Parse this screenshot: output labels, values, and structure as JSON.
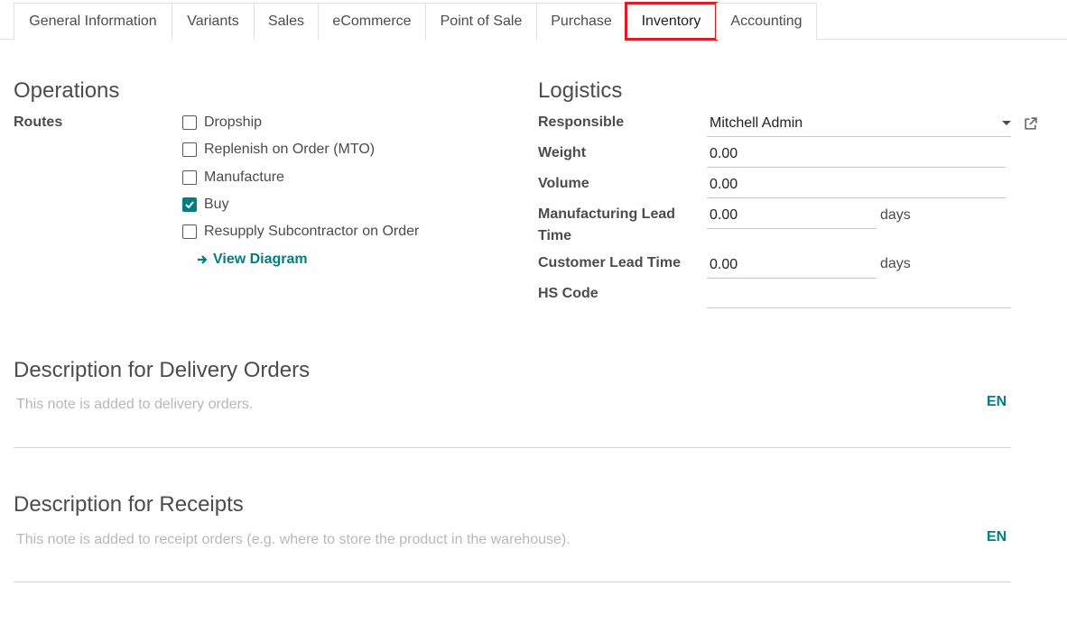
{
  "tabs": [
    {
      "label": "General Information"
    },
    {
      "label": "Variants"
    },
    {
      "label": "Sales"
    },
    {
      "label": "eCommerce"
    },
    {
      "label": "Point of Sale"
    },
    {
      "label": "Purchase"
    },
    {
      "label": "Inventory",
      "active": true
    },
    {
      "label": "Accounting"
    }
  ],
  "operations": {
    "title": "Operations",
    "routes_label": "Routes",
    "routes": [
      {
        "label": "Dropship",
        "checked": false
      },
      {
        "label": "Replenish on Order (MTO)",
        "checked": false
      },
      {
        "label": "Manufacture",
        "checked": false
      },
      {
        "label": "Buy",
        "checked": true
      },
      {
        "label": "Resupply Subcontractor on Order",
        "checked": false
      }
    ],
    "view_diagram": "View Diagram"
  },
  "logistics": {
    "title": "Logistics",
    "responsible_label": "Responsible",
    "responsible_value": "Mitchell Admin",
    "weight_label": "Weight",
    "weight_value": "0.00",
    "volume_label": "Volume",
    "volume_value": "0.00",
    "mfg_lead_label_line1": "Manufacturing Lead",
    "mfg_lead_label_line2": "Time",
    "mfg_lead_value": "0.00",
    "mfg_lead_unit": "days",
    "customer_lead_label": "Customer Lead Time",
    "customer_lead_value": "0.00",
    "customer_lead_unit": "days",
    "hs_code_label": "HS Code",
    "hs_code_value": ""
  },
  "delivery_desc": {
    "title": "Description for Delivery Orders",
    "placeholder": "This note is added to delivery orders.",
    "lang": "EN"
  },
  "receipt_desc": {
    "title": "Description for Receipts",
    "placeholder": "This note is added to receipt orders (e.g. where to store the product in the warehouse).",
    "lang": "EN"
  },
  "colors": {
    "accent": "#017e84",
    "highlight": "#e01b24"
  }
}
